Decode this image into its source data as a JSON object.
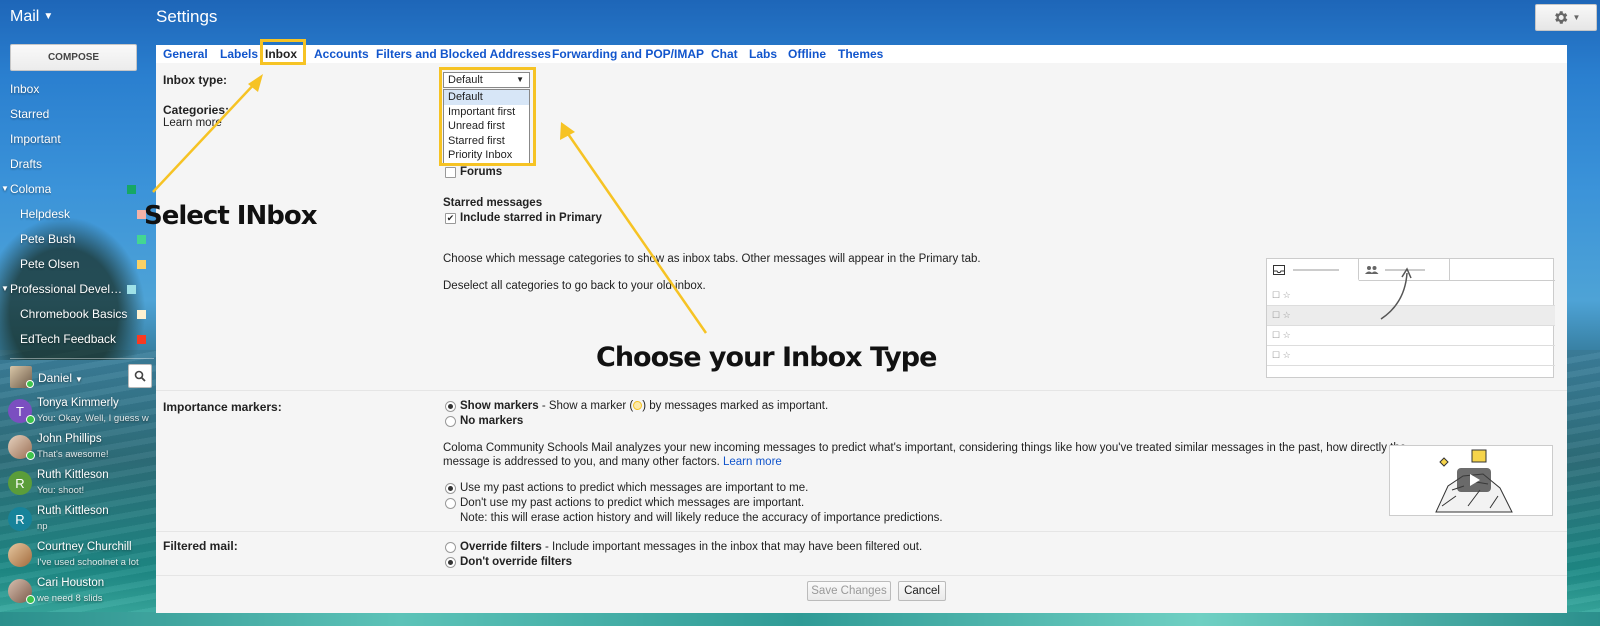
{
  "app": {
    "brand": "Mail",
    "page_title": "Settings"
  },
  "sidebar": {
    "compose_label": "COMPOSE",
    "items": [
      {
        "label": "Inbox"
      },
      {
        "label": "Starred"
      },
      {
        "label": "Important"
      },
      {
        "label": "Drafts"
      },
      {
        "label": "Coloma",
        "color": "#16a765",
        "expanded": true
      },
      {
        "label": "Helpdesk",
        "color": "#f2b2a8",
        "indent": true
      },
      {
        "label": "Pete Bush",
        "color": "#43d692",
        "indent": true
      },
      {
        "label": "Pete Olsen",
        "color": "#fad165",
        "indent": true
      },
      {
        "label": "Professional Develop…",
        "color": "#9fe1e7",
        "expanded": true
      },
      {
        "label": "Chromebook Basics",
        "color": "#fef1d1",
        "indent": true
      },
      {
        "label": "EdTech Feedback",
        "color": "#f83a22",
        "indent": true
      }
    ]
  },
  "chat": {
    "me_name": "Daniel",
    "contacts": [
      {
        "name": "Tonya Kimmerly",
        "message": "You: Okay. Well, I guess w",
        "initial": "T",
        "color": "#7b4fc0"
      },
      {
        "name": "John Phillips",
        "message": "That's awesome!",
        "initial": "",
        "color": "#b98c70"
      },
      {
        "name": "Ruth Kittleson",
        "message": "You: shoot!",
        "initial": "R",
        "color": "#5b9d3a"
      },
      {
        "name": "Ruth Kittleson",
        "message": "np",
        "initial": "R",
        "color": "#17839a"
      },
      {
        "name": "Courtney Churchill",
        "message": "I've used schoolnet a lot",
        "initial": "",
        "color": "#c09060"
      },
      {
        "name": "Cari Houston",
        "message": "we need 8 slids",
        "initial": "",
        "color": "#8a6e60"
      }
    ]
  },
  "tabs": [
    {
      "label": "General"
    },
    {
      "label": "Labels"
    },
    {
      "label": "Inbox",
      "active": true
    },
    {
      "label": "Accounts"
    },
    {
      "label": "Filters and Blocked Addresses"
    },
    {
      "label": "Forwarding and POP/IMAP"
    },
    {
      "label": "Chat"
    },
    {
      "label": "Labs"
    },
    {
      "label": "Offline"
    },
    {
      "label": "Themes"
    }
  ],
  "inbox_type": {
    "label": "Inbox type:",
    "selected": "Default",
    "options": [
      "Default",
      "Important first",
      "Unread first",
      "Starred first",
      "Priority Inbox"
    ]
  },
  "categories": {
    "label": "Categories:",
    "learn_more": "Learn more",
    "forums_label": "Forums",
    "starred_heading": "Starred messages",
    "include_starred": "Include starred in Primary",
    "desc1": "Choose which message categories to show as inbox tabs. Other messages will appear in the Primary tab.",
    "desc2": "Deselect all categories to go back to your old inbox."
  },
  "importance": {
    "label": "Importance markers:",
    "show_markers": "Show markers",
    "show_markers_desc_a": " - Show a marker (",
    "show_markers_desc_b": ") by messages marked as important.",
    "no_markers": "No markers",
    "analysis": "Coloma Community Schools Mail analyzes your new incoming messages to predict what's important, considering things like how you've treated similar messages in the past, how directly the",
    "analysis2": "message is addressed to you, and many other factors.",
    "learn_more": "Learn more",
    "use_past": "Use my past actions to predict which messages are important to me.",
    "dont_use_past": "Don't use my past actions to predict which messages are important.",
    "note": "Note: this will erase action history and will likely reduce the accuracy of importance predictions."
  },
  "filtered": {
    "label": "Filtered mail:",
    "override": "Override filters",
    "override_desc": " - Include important messages in the inbox that may have been filtered out.",
    "dont_override": "Don't override filters"
  },
  "buttons": {
    "save": "Save Changes",
    "cancel": "Cancel"
  },
  "annotations": {
    "select_inbox": "Select INbox",
    "choose_type": "Choose your Inbox Type",
    "color": "#f6c324"
  }
}
